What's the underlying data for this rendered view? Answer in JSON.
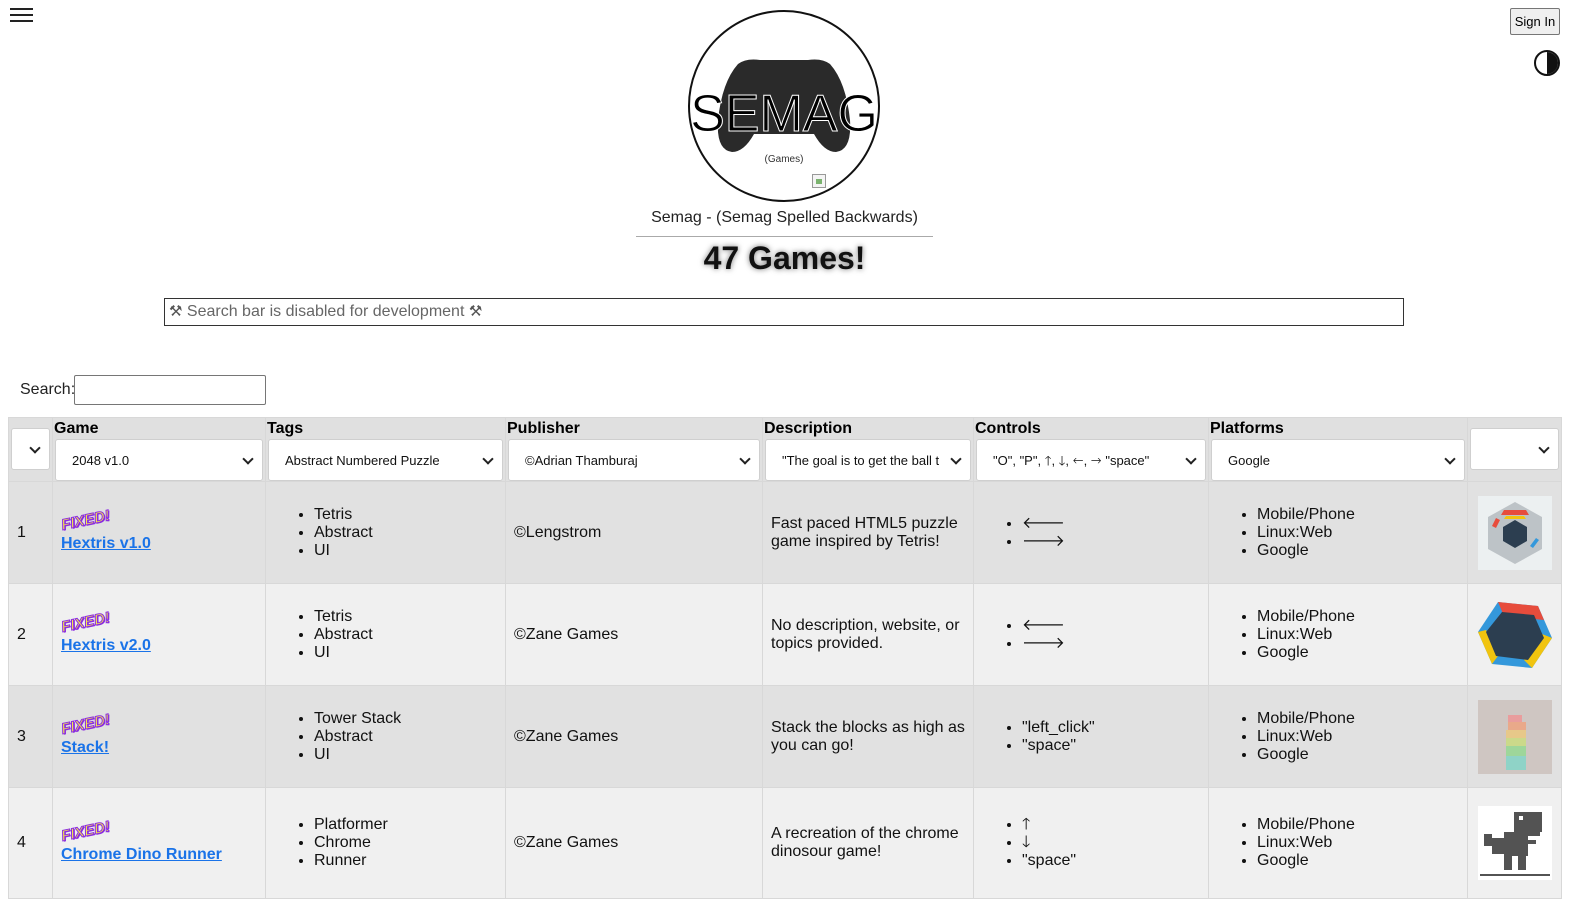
{
  "header": {
    "sign_in_label": "Sign In",
    "logo_text": "SEMAG",
    "logo_subtext": "(Games)",
    "tagline": "Semag - (Semag Spelled Backwards)",
    "game_count": "47 Games!",
    "dev_search_placeholder": "Search bar is disabled for development"
  },
  "search": {
    "label": "Search:",
    "value": ""
  },
  "table": {
    "columns": [
      {
        "label": "",
        "filter": ""
      },
      {
        "label": "Game",
        "filter": "2048 v1.0"
      },
      {
        "label": "Tags",
        "filter": "Abstract Numbered Puzzle"
      },
      {
        "label": "Publisher",
        "filter": "©Adrian Thamburaj"
      },
      {
        "label": "Description",
        "filter": "\"The goal is to get the ball t"
      },
      {
        "label": "Controls",
        "filter": "\"O\", \"P\", 🡑, 🡓, 🡐, 🡒 \"space\""
      },
      {
        "label": "Platforms",
        "filter": "Google"
      },
      {
        "label": "",
        "filter": ""
      }
    ],
    "rows": [
      {
        "num": "1",
        "badge": "FIXED!",
        "game": "Hextris v1.0",
        "tags": [
          "Tetris",
          "Abstract",
          "UI"
        ],
        "publisher": "©Lengstrom",
        "description": "Fast paced HTML5 puzzle game inspired by Tetris!",
        "controls": [
          "🡐",
          "🡒"
        ],
        "platforms": [
          "Mobile/Phone",
          "Linux:Web",
          "Google"
        ],
        "thumb": "hextris-v1-thumbnail"
      },
      {
        "num": "2",
        "badge": "FIXED!",
        "game": "Hextris v2.0",
        "tags": [
          "Tetris",
          "Abstract",
          "UI"
        ],
        "publisher": "©Zane Games",
        "description": "No description, website, or topics provided.",
        "controls": [
          "🡐",
          "🡒"
        ],
        "platforms": [
          "Mobile/Phone",
          "Linux:Web",
          "Google"
        ],
        "thumb": "hextris-v2-thumbnail"
      },
      {
        "num": "3",
        "badge": "FIXED!",
        "game": "Stack!",
        "tags": [
          "Tower Stack",
          "Abstract",
          "UI"
        ],
        "publisher": "©Zane Games",
        "description": "Stack the blocks as high as you can go!",
        "controls": [
          "\"left_click\"",
          "\"space\""
        ],
        "platforms": [
          "Mobile/Phone",
          "Linux:Web",
          "Google"
        ],
        "thumb": "stack-thumbnail"
      },
      {
        "num": "4",
        "badge": "FIXED!",
        "game": "Chrome Dino Runner",
        "tags": [
          "Platformer",
          "Chrome",
          "Runner"
        ],
        "publisher": "©Zane Games",
        "description": "A recreation of the chrome dinosour game!",
        "controls": [
          "🡑",
          "🡓",
          "\"space\""
        ],
        "platforms": [
          "Mobile/Phone",
          "Linux:Web",
          "Google"
        ],
        "thumb": "dino-thumbnail"
      }
    ]
  }
}
